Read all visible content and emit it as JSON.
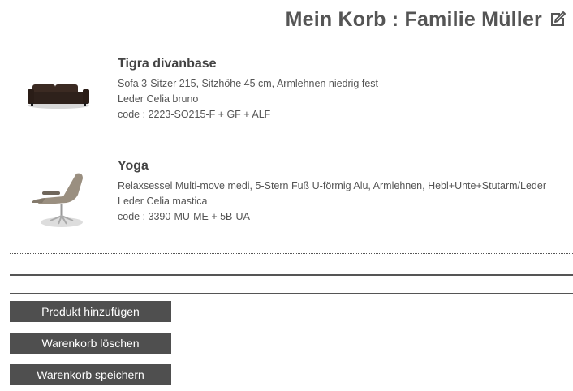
{
  "header": {
    "title": "Mein Korb : Familie Müller",
    "edit_icon": "edit-icon"
  },
  "items": [
    {
      "name": "Tigra divanbase",
      "description": "Sofa 3-Sitzer 215, Sitzhöhe 45 cm, Armlehnen niedrig fest",
      "material": "Leder Celia bruno",
      "code": "code : 2223-SO215-F + GF + ALF",
      "image": "sofa-image"
    },
    {
      "name": "Yoga",
      "description": "Relaxsessel Multi-move medi, 5-Stern Fuß U-förmig Alu, Armlehnen, Hebl+Unte+Stutarm/Leder",
      "material": "Leder Celia mastica",
      "code": "code : 3390-MU-ME + 5B-UA",
      "image": "armchair-image"
    }
  ],
  "actions": {
    "add_product": "Produkt hinzufügen",
    "clear_cart": "Warenkorb löschen",
    "save_cart": "Warenkorb speichern"
  },
  "colors": {
    "button_bg": "#4f4f4f",
    "text": "#444444"
  }
}
